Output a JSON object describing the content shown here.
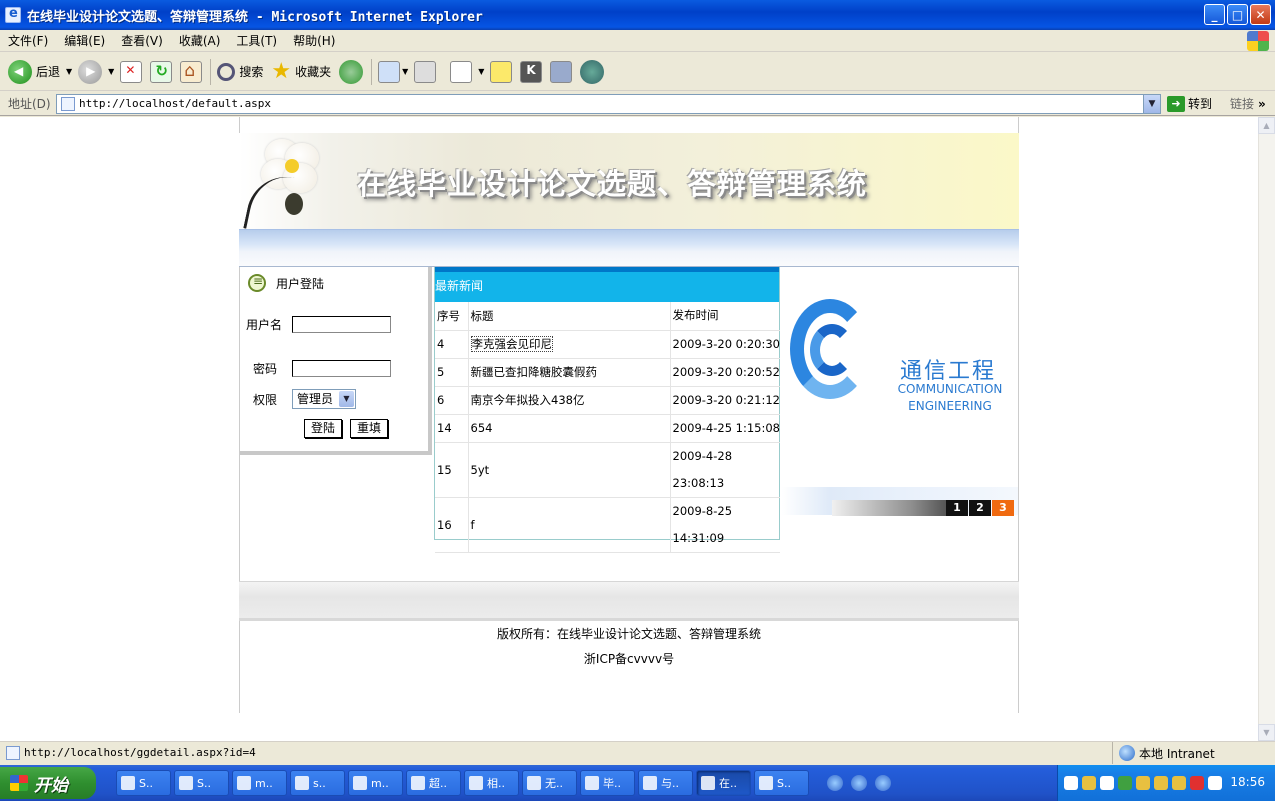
{
  "window": {
    "title": "在线毕业设计论文选题、答辩管理系统 - Microsoft Internet Explorer"
  },
  "menu": [
    "文件(F)",
    "编辑(E)",
    "查看(V)",
    "收藏(A)",
    "工具(T)",
    "帮助(H)"
  ],
  "toolbar": {
    "back": "后退",
    "search": "搜索",
    "favorites": "收藏夹"
  },
  "address": {
    "label": "地址(D)",
    "url": "http://localhost/default.aspx",
    "go": "转到",
    "links": "链接"
  },
  "banner": {
    "title": "在线毕业设计论文选题、答辩管理系统"
  },
  "login": {
    "title": "用户登陆",
    "username_label": "用户名",
    "password_label": "密码",
    "role_label": "权限",
    "role_value": "管理员",
    "login_button": "登陆",
    "reset_button": "重填"
  },
  "news": {
    "title": "最新新闻",
    "columns": [
      "序号",
      "标题",
      "发布时间"
    ],
    "rows": [
      {
        "id": "4",
        "title": "李克强会见印尼",
        "date": "2009-3-20 0:20:30"
      },
      {
        "id": "5",
        "title": "新疆已查扣降糖胶囊假药",
        "date": "2009-3-20 0:20:52"
      },
      {
        "id": "6",
        "title": "南京今年拟投入438亿",
        "date": "2009-3-20 0:21:12"
      },
      {
        "id": "14",
        "title": "654",
        "date": "2009-4-25 1:15:08"
      },
      {
        "id": "15",
        "title": "5yt",
        "date": "2009-4-28 23:08:13"
      },
      {
        "id": "16",
        "title": "f",
        "date": "2009-8-25 14:31:09"
      }
    ]
  },
  "logo": {
    "cn": "通信工程",
    "en_line1": "COMMUNICATION",
    "en_line2": "ENGINEERING"
  },
  "pager": [
    "1",
    "2",
    "3"
  ],
  "footer": {
    "copyright": "版权所有：在线毕业设计论文选题、答辩管理系统",
    "icp": "浙ICP备cvvvv号"
  },
  "status": {
    "text": "http://localhost/ggdetail.aspx?id=4",
    "zone": "本地 Intranet"
  },
  "taskbar": {
    "start": "开始",
    "tasks": [
      "S..",
      "S..",
      "m..",
      "s..",
      "m..",
      "超..",
      "相..",
      "无..",
      "毕..",
      "与..",
      "在..",
      "S.."
    ],
    "clock": "18:56"
  }
}
